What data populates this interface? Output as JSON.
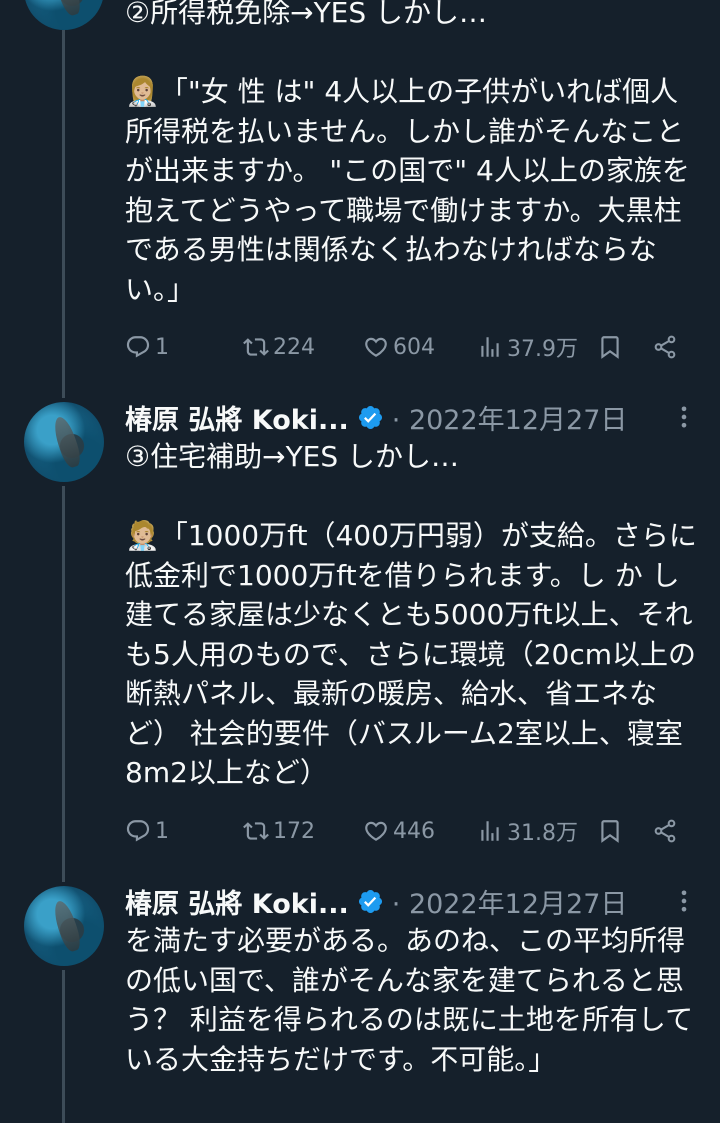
{
  "tweets": [
    {
      "body": "②所得税免除→YES しかし…\n\n👩🏼‍⚕️「\"女 性 は\" 4人以上の子供がいれば個人所得税を払いません。しかし誰がそんなことが出来ますか。 \"この国で\" 4人以上の家族を抱えてどうやって職場で働けますか。大黒柱である男性は関係なく払わなければならない。」",
      "replies": "1",
      "retweets": "224",
      "likes": "604",
      "views": "37.9万"
    },
    {
      "author": "椿原 弘將 Koki...",
      "date": "· 2022年12月27日",
      "body": "③住宅補助→YES しかし…\n\n🧑🏼‍⚕️「1000万ft（400万円弱）が支給。さらに低金利で1000万ftを借りられます。し か し 建てる家屋は少なくとも5000万ft以上、それも5人用のもので、さらに環境（20cm以上の断熱パネル、最新の暖房、給水、省エネなど） 社会的要件（バスルーム2室以上、寝室8m2以上など）",
      "replies": "1",
      "retweets": "172",
      "likes": "446",
      "views": "31.8万"
    },
    {
      "author": "椿原 弘將 Koki...",
      "date": "· 2022年12月27日",
      "body": "を満たす必要がある。あのね、この平均所得の低い国で、誰がそんな家を建てられると思う？ 利益を得られるのは既に土地を所有している大金持ちだけです。不可能。」"
    }
  ],
  "icons": {
    "reply": "reply-icon",
    "retweet": "retweet-icon",
    "like": "heart-icon",
    "views": "views-icon",
    "bookmark": "bookmark-icon",
    "share": "share-icon",
    "verified": "verified-badge-icon",
    "more": "more-icon"
  },
  "colors": {
    "background": "#15202b",
    "text": "#f7f9f9",
    "muted": "#8b98a5",
    "verified": "#1d9bf0",
    "thread_line": "#3d4c58"
  }
}
